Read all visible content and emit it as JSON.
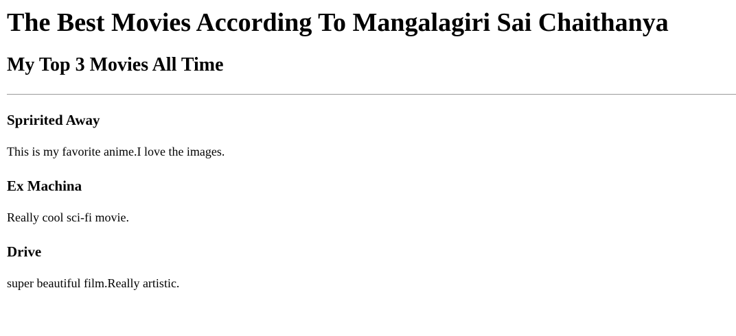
{
  "page": {
    "title": "The Best Movies According To Mangalagiri Sai Chaithanya",
    "subtitle": "My Top 3 Movies All Time"
  },
  "movies": [
    {
      "title": "Spririted Away",
      "description": "This is my favorite anime.I love the images."
    },
    {
      "title": "Ex Machina",
      "description": "Really cool sci-fi movie."
    },
    {
      "title": "Drive",
      "description": "super beautiful film.Really artistic."
    }
  ]
}
